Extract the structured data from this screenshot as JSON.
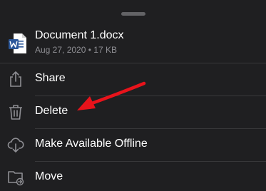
{
  "file": {
    "icon": "word-document-icon",
    "name": "Document 1.docx",
    "meta": "Aug 27, 2020 • 17 KB"
  },
  "menu": {
    "items": [
      {
        "label": "Share",
        "icon": "share-icon"
      },
      {
        "label": "Delete",
        "icon": "trash-icon"
      },
      {
        "label": "Make Available Offline",
        "icon": "cloud-download-icon"
      },
      {
        "label": "Move",
        "icon": "folder-move-icon"
      }
    ]
  },
  "annotation": {
    "icon": "red-arrow-icon",
    "color": "#e8131b"
  },
  "colors": {
    "background": "#1f1f21",
    "icon_gray": "#8e8e93",
    "word_blue": "#2b579a"
  }
}
